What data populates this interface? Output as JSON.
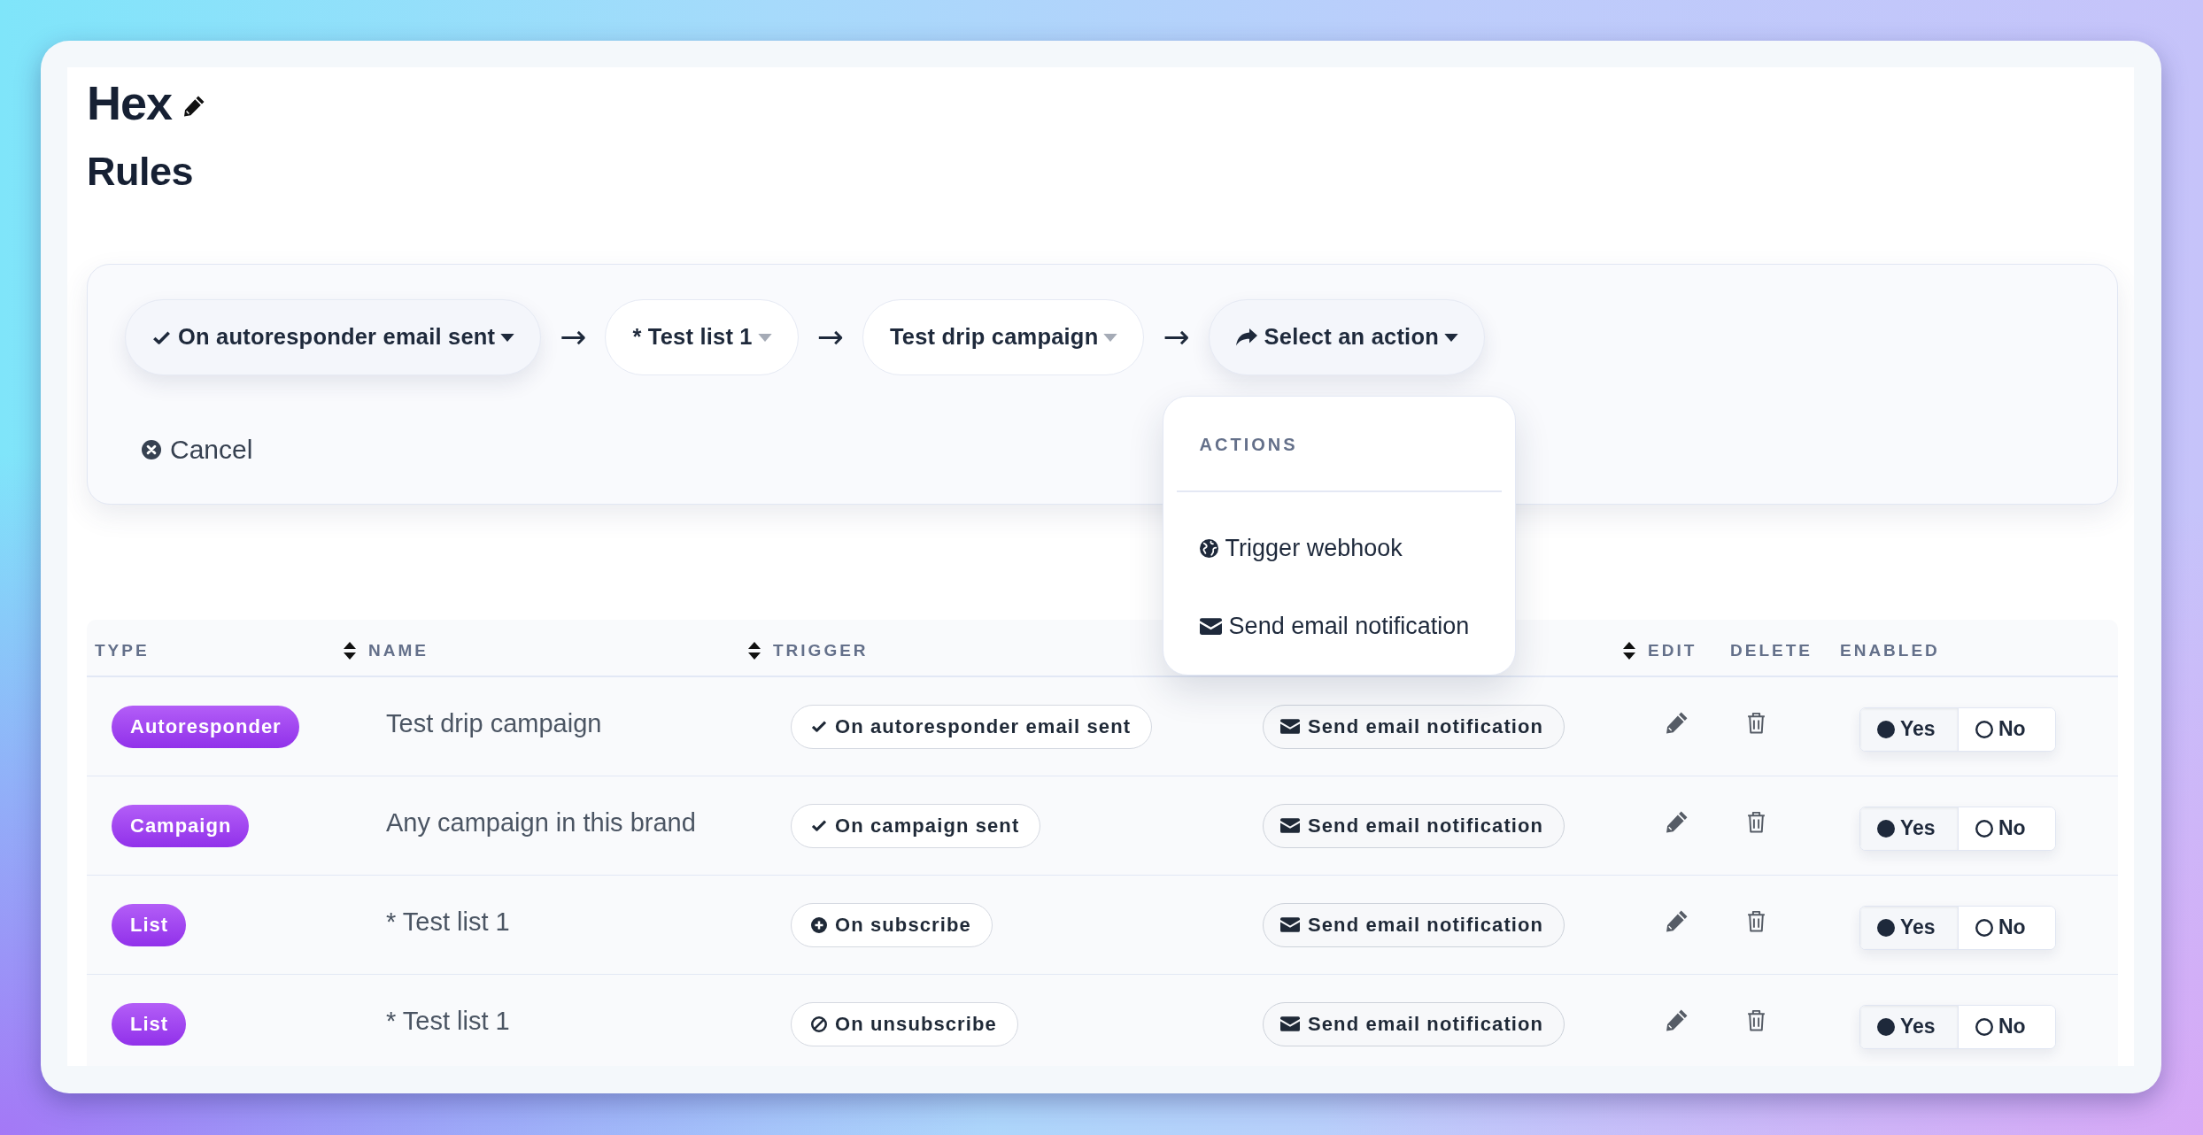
{
  "header": {
    "title": "Hex",
    "heading": "Rules"
  },
  "rule_builder": {
    "steps": [
      {
        "kind": "trigger",
        "label": "On autoresponder email sent"
      },
      {
        "kind": "select",
        "separator": "→",
        "label": "* Test list 1"
      },
      {
        "kind": "select",
        "separator": "→",
        "label": "Test drip campaign"
      },
      {
        "kind": "action",
        "separator": "→",
        "label": "Select an action",
        "menu": {
          "heading": "ACTIONS",
          "items": [
            {
              "kind": "webhook",
              "label": "Trigger webhook"
            },
            {
              "kind": "email",
              "label": "Send email notification"
            }
          ]
        }
      }
    ],
    "cancel": "Cancel"
  },
  "table": {
    "columns": [
      {
        "label": "TYPE",
        "sortable": false
      },
      {
        "label": "NAME",
        "sortable": true
      },
      {
        "label": "TRIGGER",
        "sortable": true
      },
      {
        "label": "EDIT",
        "sortable": true
      },
      {
        "label": "DELETE",
        "sortable": false
      },
      {
        "label": "ENABLED",
        "sortable": false
      }
    ],
    "rows": [
      {
        "type": "Autoresponder",
        "name": "Test drip campaign",
        "trigger": {
          "kind": "sent",
          "label": "On autoresponder email sent"
        },
        "action": {
          "kind": "email",
          "label": "Send email notification"
        },
        "enabled": [
          {
            "label": "Yes",
            "selected": true
          },
          {
            "label": "No",
            "selected": false
          }
        ]
      },
      {
        "type": "Campaign",
        "name": "Any campaign in this brand",
        "trigger": {
          "kind": "sent",
          "label": "On campaign sent"
        },
        "action": {
          "kind": "email",
          "label": "Send email notification"
        },
        "enabled": [
          {
            "label": "Yes",
            "selected": true
          },
          {
            "label": "No",
            "selected": false
          }
        ]
      },
      {
        "type": "List",
        "name": "* Test list 1",
        "trigger": {
          "kind": "subscribe",
          "label": "On subscribe"
        },
        "action": {
          "kind": "email",
          "label": "Send email notification"
        },
        "enabled": [
          {
            "label": "Yes",
            "selected": true
          },
          {
            "label": "No",
            "selected": false
          }
        ]
      },
      {
        "type": "List",
        "name": "* Test list 1",
        "trigger": {
          "kind": "unsubscribe",
          "label": "On unsubscribe"
        },
        "action": {
          "kind": "email",
          "label": "Send email notification"
        },
        "enabled": [
          {
            "label": "Yes",
            "selected": true
          },
          {
            "label": "No",
            "selected": false
          }
        ]
      }
    ]
  }
}
